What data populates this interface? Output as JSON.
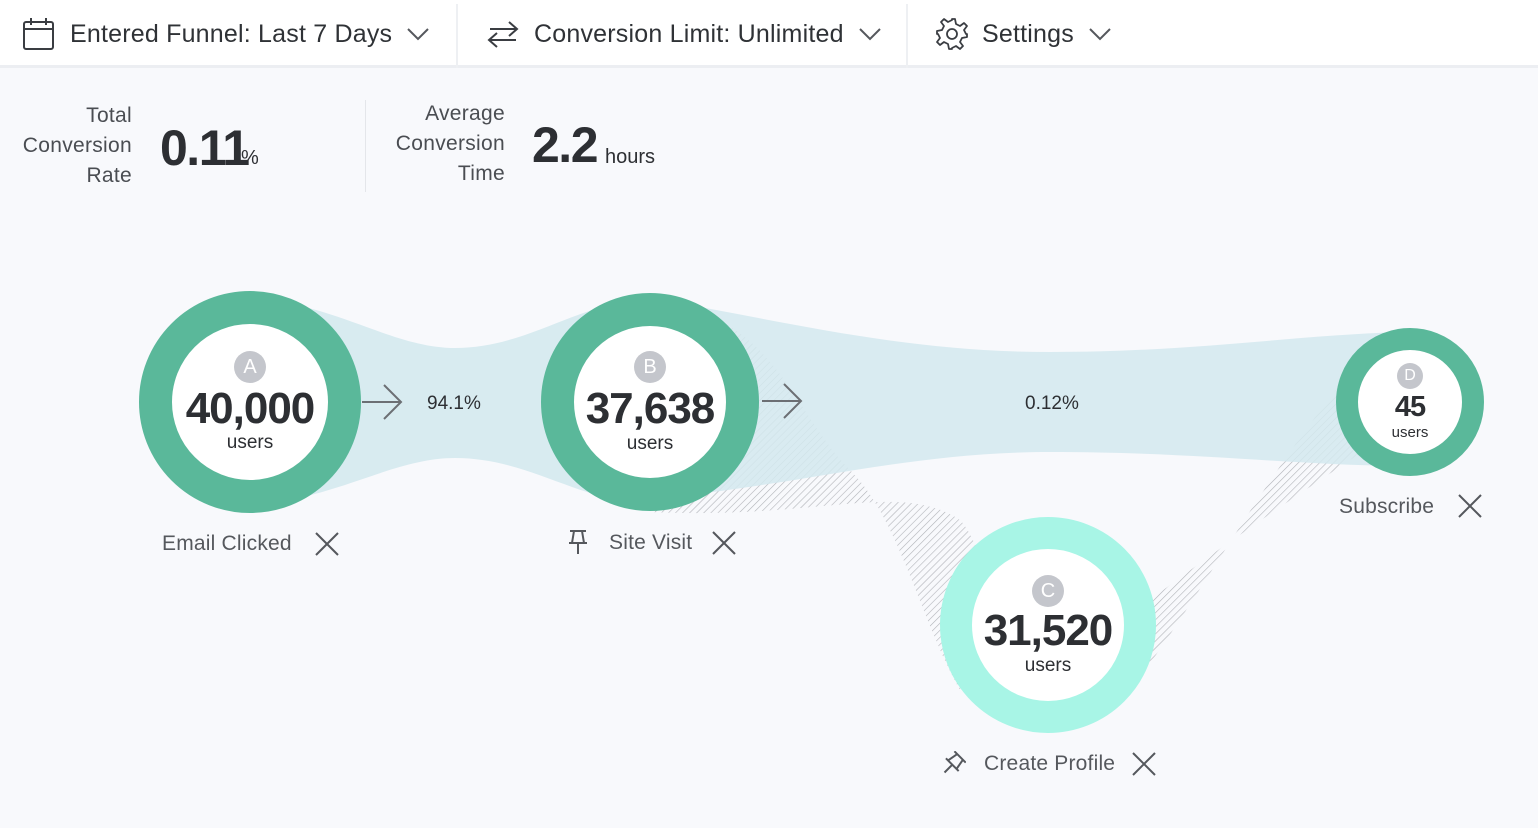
{
  "toolbar": {
    "entered_funnel": "Entered Funnel: Last 7 Days",
    "conversion_limit": "Conversion Limit: Unlimited",
    "settings": "Settings",
    "icons": [
      "calendar-icon",
      "swap-arrows-icon",
      "gear-icon",
      "chevron-down-icon"
    ]
  },
  "metrics": {
    "total": {
      "label_1": "Total",
      "label_2": "Conversion",
      "label_3": "Rate",
      "value": "0.11",
      "unit": "%"
    },
    "average": {
      "label_1": "Average",
      "label_2": "Conversion",
      "label_3": "Time",
      "value": "2.2",
      "unit": "hours"
    }
  },
  "colors": {
    "ring_green": "#5ab89a",
    "ring_mint": "#a8f5e6",
    "flow_blue": "#d4e9ee",
    "hatch": "#9a9ca2",
    "badge": "#c4c6cc"
  },
  "funnel": {
    "steps": [
      {
        "letter": "A",
        "count": "40,000",
        "users": "users",
        "name": "Email Clicked"
      },
      {
        "letter": "B",
        "count": "37,638",
        "users": "users",
        "name": "Site Visit"
      },
      {
        "letter": "C",
        "count": "31,520",
        "users": "users",
        "name": "Create Profile"
      },
      {
        "letter": "D",
        "count": "45",
        "users": "users",
        "name": "Subscribe"
      }
    ],
    "conversions": {
      "a_to_b": "94.1%",
      "b_to_d": "0.12%"
    }
  }
}
